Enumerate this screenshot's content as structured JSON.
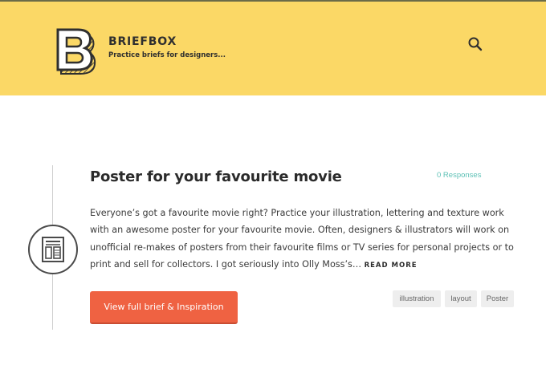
{
  "header": {
    "brand_name": "BRIEFBOX",
    "tagline": "Practice briefs for designers...",
    "logo_icon": "b-logo-icon",
    "search_icon": "search-icon"
  },
  "post": {
    "title": "Poster for your favourite movie",
    "responses": "0 Responses",
    "excerpt": "Everyone’s got a favourite movie right? Practice your illustration, lettering and texture work with an awesome poster for your favourite movie. Often, designers & illustrators will work on unofficial re-makes of posters from their favourite films or TV series for personal projects or to print and sell for collectors. I got seriously into Olly Moss’s…",
    "read_more": "READ MORE",
    "cta_label": "View full brief & Inspiration",
    "category_icon": "poster-icon",
    "tags": [
      "illustration",
      "layout",
      "Poster"
    ]
  },
  "colors": {
    "header_bg": "#fbd866",
    "accent": "#ef6242",
    "responses": "#5ec1b6"
  }
}
